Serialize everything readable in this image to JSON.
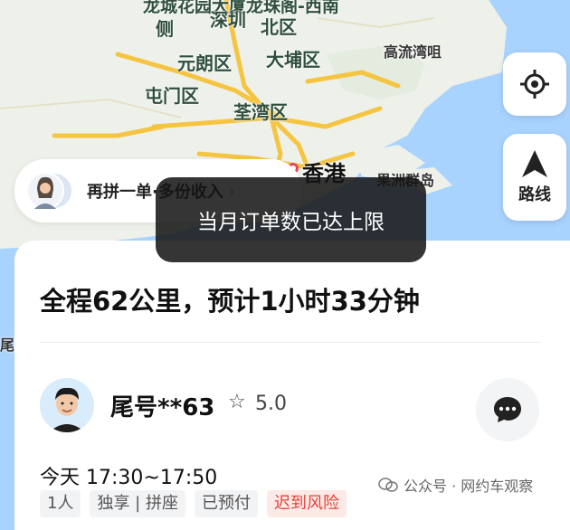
{
  "map": {
    "top_label": "龙城花园大厦龙珠阁-西南",
    "top_label_2": "侧",
    "districts": [
      {
        "name": "深圳"
      },
      {
        "name": "北区"
      },
      {
        "name": "元朗区"
      },
      {
        "name": "大埔区"
      },
      {
        "name": "高流湾咀"
      },
      {
        "name": "屯门区"
      },
      {
        "name": "荃湾区"
      },
      {
        "name": "香港"
      },
      {
        "name": "果洲群岛"
      }
    ],
    "edge_label": "尾"
  },
  "locate_button": {
    "icon": "locate-icon"
  },
  "route_button": {
    "label": "路线",
    "icon": "navigation-arrow-icon"
  },
  "pool_banner": {
    "text": "再拼一单·多份收入",
    "chevron": "›"
  },
  "toast": {
    "text": "当月订单数已达上限"
  },
  "trip": {
    "summary": "全程62公里，预计1小时33分钟",
    "driver": {
      "name": "尾号**63",
      "rating": "5.0"
    },
    "time": "今天 17:30~17:50",
    "tags": [
      "1人",
      "独享 | 拼座",
      "已预付",
      "迟到风险"
    ]
  },
  "watermark": {
    "text": "公众号 · 网约车观察"
  },
  "colors": {
    "accent": "#e0453b",
    "toast_bg": "#141414",
    "map_water": "#a9d3ff",
    "map_land": "#eef1ea",
    "road": "#f5c542"
  }
}
